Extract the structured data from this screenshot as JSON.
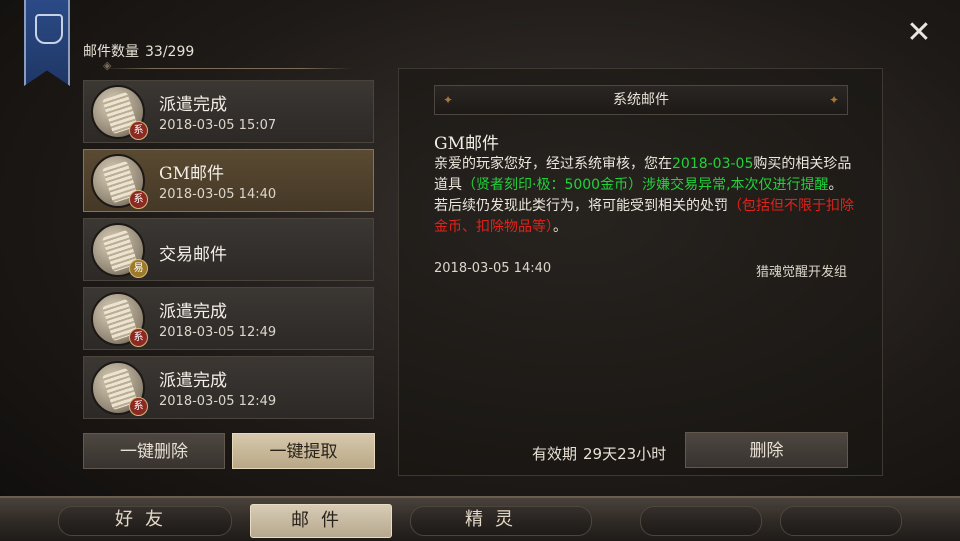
{
  "header": {
    "close_glyph": "✕",
    "mail_count_label": "邮件数量",
    "mail_count_value": "33/299"
  },
  "mail_list": [
    {
      "title": "派遣完成",
      "time": "2018-03-05 15:07",
      "badge": "系",
      "selected": false
    },
    {
      "title": "GM邮件",
      "time": "2018-03-05 14:40",
      "badge": "系",
      "selected": true
    },
    {
      "title": "交易邮件",
      "time": "",
      "badge": "易",
      "selected": false
    },
    {
      "title": "派遣完成",
      "time": "2018-03-05 12:49",
      "badge": "系",
      "selected": false
    },
    {
      "title": "派遣完成",
      "time": "2018-03-05 12:49",
      "badge": "系",
      "selected": false
    }
  ],
  "actions": {
    "delete_all": "一键删除",
    "collect_all": "一键提取"
  },
  "detail": {
    "header": "系统邮件",
    "title": "GM邮件",
    "body": {
      "p1": "亲爱的玩家您好，经过系统审核，您在",
      "date_hl": "2018-03-05",
      "p2": "购买的相关珍品道具",
      "item_hl": "（贤者刻印·极：5000金币）涉嫌交易异常,本次仅进行提醒",
      "p3": "。若后续仍发现此类行为，将可能受到相关的处罚",
      "penalty_hl": "（包括但不限于扣除金币、扣除物品等）",
      "p4": "。"
    },
    "date": "2018-03-05 14:40",
    "sender": "猎魂觉醒开发组",
    "validity_label": "有效期",
    "validity_value": "29天23小时",
    "delete_button": "删除"
  },
  "tabs": [
    {
      "label": "好友",
      "active": false
    },
    {
      "label": "邮件",
      "active": true
    },
    {
      "label": "精灵",
      "active": false
    }
  ],
  "colors": {
    "highlight_green": "#22d13a",
    "highlight_red": "#e0221b",
    "banner_blue": "#2b4a86"
  }
}
